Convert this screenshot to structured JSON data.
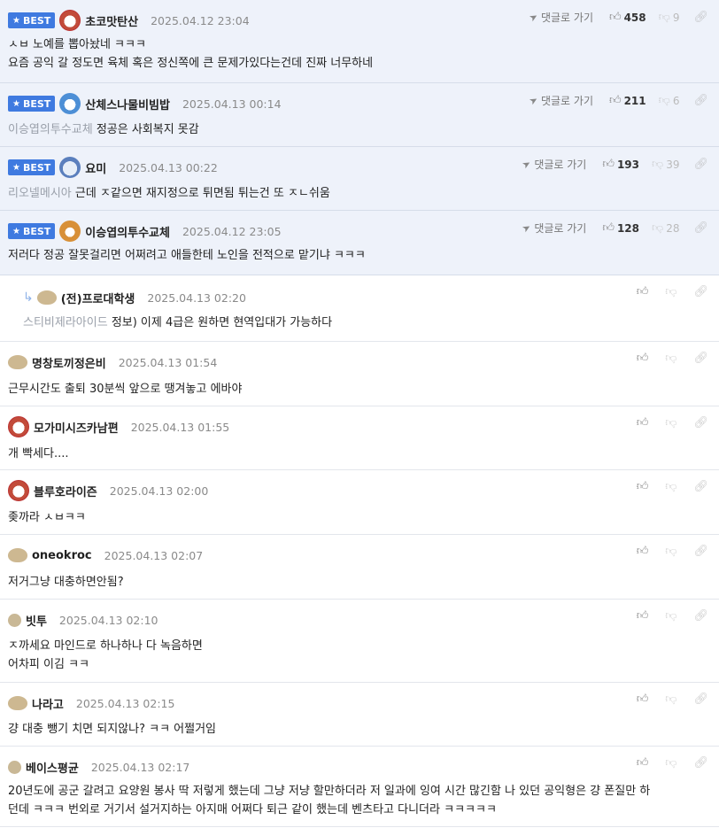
{
  "labels": {
    "best": "BEST",
    "goto": "댓글로 가기"
  },
  "comments": [
    {
      "best": true,
      "nick": "초코맛탄산",
      "date": "2025.04.12 23:04",
      "avatar": "dog",
      "likes": "458",
      "dislikes": "9",
      "quote": "",
      "lines": [
        "ㅅㅂ 노예를 뽑아놨네 ㅋㅋㅋ",
        "요즘 공익 갈 정도면 육체 혹은 정신쪽에 큰 문제가있다는건데 진짜 너무하네"
      ]
    },
    {
      "best": true,
      "nick": "산체스나물비빔밥",
      "date": "2025.04.13 00:14",
      "avatar": "blue",
      "likes": "211",
      "dislikes": "6",
      "quote": "이승엽의투수교체",
      "lines": [
        "정공은 사회복지 못감"
      ]
    },
    {
      "best": true,
      "nick": "요미",
      "date": "2025.04.13 00:22",
      "avatar": "pale",
      "likes": "193",
      "dislikes": "39",
      "quote": "리오넬메시아",
      "lines": [
        "근데 ㅈ같으면 재지정으로 튀면됨 튀는건 또 ㅈㄴ쉬움"
      ]
    },
    {
      "best": true,
      "nick": "이승엽의투수교체",
      "date": "2025.04.12 23:05",
      "avatar": "fox",
      "likes": "128",
      "dislikes": "28",
      "quote": "",
      "lines": [
        "저러다 정공 잘못걸리면 어쩌려고 애들한테 노인을 전적으로 맡기냐 ㅋㅋㅋ"
      ]
    },
    {
      "best": false,
      "reply": true,
      "nick": "(전)프로대학생",
      "date": "2025.04.13 02:20",
      "avatar": "blob",
      "quote": "스티비제라아이드",
      "lines": [
        "정보) 이제 4급은 원하면 현역입대가 가능하다"
      ]
    },
    {
      "best": false,
      "nick": "명창토끼정은비",
      "date": "2025.04.13 01:54",
      "avatar": "blob",
      "quote": "",
      "lines": [
        "근무시간도 출퇴 30분씩 앞으로 땡겨놓고 에바야"
      ]
    },
    {
      "best": false,
      "nick": "모가미시즈카남편",
      "date": "2025.04.13 01:55",
      "avatar": "dog",
      "quote": "",
      "lines": [
        "개 빡세다...."
      ]
    },
    {
      "best": false,
      "nick": "블루호라이즌",
      "date": "2025.04.13 02:00",
      "avatar": "dog",
      "quote": "",
      "lines": [
        "좆까라 ㅅㅂㅋㅋ"
      ]
    },
    {
      "best": false,
      "nick": "oneokroc",
      "date": "2025.04.13 02:07",
      "avatar": "blob",
      "quote": "",
      "lines": [
        "저거그냥 대충하면안됨?"
      ]
    },
    {
      "best": false,
      "nick": "빗투",
      "date": "2025.04.13 02:10",
      "avatar": "dot",
      "quote": "",
      "lines": [
        "ㅈ까세요 마인드로 하나하나 다 녹음하면",
        "어차피 이김 ㅋㅋ"
      ]
    },
    {
      "best": false,
      "nick": "나라고",
      "date": "2025.04.13 02:15",
      "avatar": "blob",
      "quote": "",
      "lines": [
        "걍 대충 뺑기 치면 되지않나? ㅋㅋ 어쩔거임"
      ]
    },
    {
      "best": false,
      "nick": "베이스평균",
      "date": "2025.04.13 02:17",
      "avatar": "dot",
      "quote": "",
      "lines": [
        "20년도에 공군 갈려고 요양원 봉사 딱 저렇게 했는데 그냥 저냥 할만하더라 저 일과에 잉여 시간 많긴함 나 있던 공익형은 걍 폰질만 하",
        "던데 ㅋㅋㅋ 번외로 거기서 설거지하는 아지매 어쩌다 퇴근 같이 했는데 벤츠타고 다니더라 ㅋㅋㅋㅋㅋ"
      ]
    }
  ]
}
